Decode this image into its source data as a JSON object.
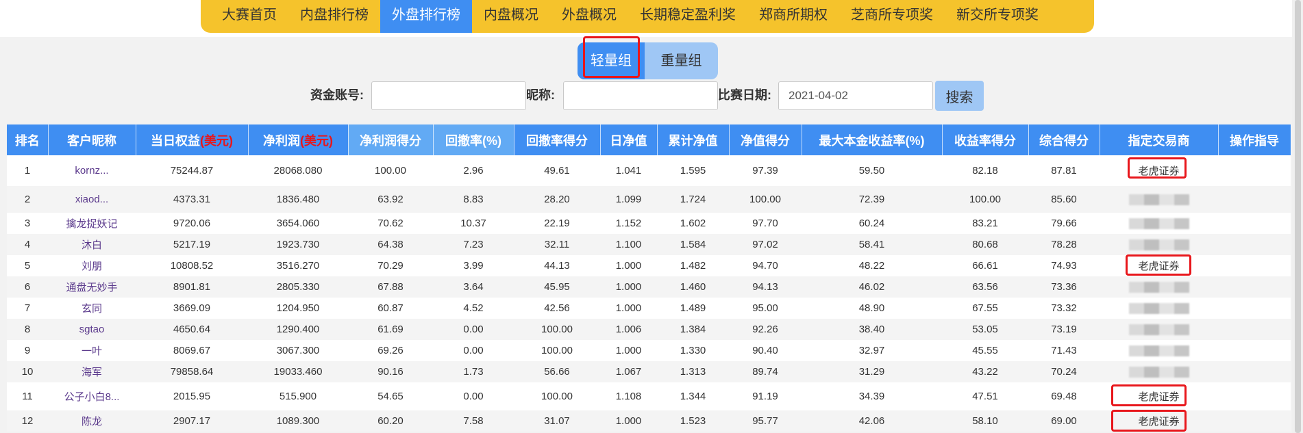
{
  "nav": {
    "items": [
      {
        "label": "大赛首页",
        "active": false
      },
      {
        "label": "内盘排行榜",
        "active": false
      },
      {
        "label": "外盘排行榜",
        "active": true
      },
      {
        "label": "内盘概况",
        "active": false
      },
      {
        "label": "外盘概况",
        "active": false
      },
      {
        "label": "长期稳定盈利奖",
        "active": false
      },
      {
        "label": "郑商所期权",
        "active": false
      },
      {
        "label": "芝商所专项奖",
        "active": false
      },
      {
        "label": "新交所专项奖",
        "active": false
      }
    ]
  },
  "groups": {
    "light": "轻量组",
    "heavy": "重量组"
  },
  "search": {
    "account_label": "资金账号:",
    "account_value": "",
    "nickname_label": "昵称:",
    "nickname_value": "",
    "date_label": "比赛日期:",
    "date_value": "2021-04-02",
    "button": "搜索"
  },
  "table": {
    "headers": {
      "rank": "排名",
      "nickname": "客户昵称",
      "equity": "当日权益",
      "profit": "净利润",
      "usd": "(美元)",
      "profit_score": "净利润得分",
      "drawdown": "回撤率(%)",
      "drawdown_score": "回撤率得分",
      "daily_nav": "日净值",
      "cum_nav": "累计净值",
      "nav_score": "净值得分",
      "max_return": "最大本金收益率(%)",
      "return_score": "收益率得分",
      "total_score": "综合得分",
      "broker": "指定交易商",
      "guide": "操作指导"
    },
    "rows": [
      {
        "rank": "1",
        "nickname": "kornz...",
        "equity": "75244.87",
        "profit": "28068.080",
        "profit_score": "100.00",
        "drawdown": "2.96",
        "drawdown_score": "49.61",
        "daily_nav": "1.041",
        "cum_nav": "1.595",
        "nav_score": "97.39",
        "max_return": "59.50",
        "return_score": "82.18",
        "total_score": "87.81",
        "broker": "老虎证券"
      },
      {
        "rank": "2",
        "nickname": "xiaod...",
        "equity": "4373.31",
        "profit": "1836.480",
        "profit_score": "63.92",
        "drawdown": "8.83",
        "drawdown_score": "28.20",
        "daily_nav": "1.099",
        "cum_nav": "1.724",
        "nav_score": "100.00",
        "max_return": "72.39",
        "return_score": "100.00",
        "total_score": "85.60",
        "broker": ""
      },
      {
        "rank": "3",
        "nickname": "擒龙捉妖记",
        "equity": "9720.06",
        "profit": "3654.060",
        "profit_score": "70.62",
        "drawdown": "10.37",
        "drawdown_score": "22.19",
        "daily_nav": "1.152",
        "cum_nav": "1.602",
        "nav_score": "97.70",
        "max_return": "60.24",
        "return_score": "83.21",
        "total_score": "79.66",
        "broker": ""
      },
      {
        "rank": "4",
        "nickname": "沐白",
        "equity": "5217.19",
        "profit": "1923.730",
        "profit_score": "64.38",
        "drawdown": "7.23",
        "drawdown_score": "32.11",
        "daily_nav": "1.100",
        "cum_nav": "1.584",
        "nav_score": "97.02",
        "max_return": "58.41",
        "return_score": "80.68",
        "total_score": "78.28",
        "broker": ""
      },
      {
        "rank": "5",
        "nickname": "刘朋",
        "equity": "10808.52",
        "profit": "3516.270",
        "profit_score": "70.29",
        "drawdown": "3.99",
        "drawdown_score": "44.13",
        "daily_nav": "1.000",
        "cum_nav": "1.482",
        "nav_score": "94.70",
        "max_return": "48.22",
        "return_score": "66.61",
        "total_score": "74.93",
        "broker": "老虎证券"
      },
      {
        "rank": "6",
        "nickname": "通盘无妙手",
        "equity": "8901.81",
        "profit": "2805.330",
        "profit_score": "67.88",
        "drawdown": "3.64",
        "drawdown_score": "45.95",
        "daily_nav": "1.000",
        "cum_nav": "1.460",
        "nav_score": "94.13",
        "max_return": "46.02",
        "return_score": "63.56",
        "total_score": "73.36",
        "broker": ""
      },
      {
        "rank": "7",
        "nickname": "玄同",
        "equity": "3669.09",
        "profit": "1204.950",
        "profit_score": "60.87",
        "drawdown": "4.52",
        "drawdown_score": "42.56",
        "daily_nav": "1.000",
        "cum_nav": "1.489",
        "nav_score": "95.00",
        "max_return": "48.90",
        "return_score": "67.55",
        "total_score": "73.32",
        "broker": ""
      },
      {
        "rank": "8",
        "nickname": "sgtao",
        "equity": "4650.64",
        "profit": "1290.400",
        "profit_score": "61.69",
        "drawdown": "0.00",
        "drawdown_score": "100.00",
        "daily_nav": "1.006",
        "cum_nav": "1.384",
        "nav_score": "92.26",
        "max_return": "38.40",
        "return_score": "53.05",
        "total_score": "73.19",
        "broker": ""
      },
      {
        "rank": "9",
        "nickname": "一叶",
        "equity": "8069.67",
        "profit": "3067.300",
        "profit_score": "69.26",
        "drawdown": "0.00",
        "drawdown_score": "100.00",
        "daily_nav": "1.000",
        "cum_nav": "1.330",
        "nav_score": "90.40",
        "max_return": "32.97",
        "return_score": "45.55",
        "total_score": "71.43",
        "broker": ""
      },
      {
        "rank": "10",
        "nickname": "海军",
        "equity": "79858.64",
        "profit": "19033.460",
        "profit_score": "90.16",
        "drawdown": "1.73",
        "drawdown_score": "56.66",
        "daily_nav": "1.067",
        "cum_nav": "1.313",
        "nav_score": "89.74",
        "max_return": "31.29",
        "return_score": "43.22",
        "total_score": "70.24",
        "broker": ""
      },
      {
        "rank": "11",
        "nickname": "公子小白8...",
        "equity": "2015.95",
        "profit": "515.900",
        "profit_score": "54.65",
        "drawdown": "0.00",
        "drawdown_score": "100.00",
        "daily_nav": "1.108",
        "cum_nav": "1.344",
        "nav_score": "91.19",
        "max_return": "34.39",
        "return_score": "47.51",
        "total_score": "69.48",
        "broker": "老虎证券"
      },
      {
        "rank": "12",
        "nickname": "陈龙",
        "equity": "2907.17",
        "profit": "1089.300",
        "profit_score": "60.20",
        "drawdown": "7.58",
        "drawdown_score": "31.07",
        "daily_nav": "1.000",
        "cum_nav": "1.523",
        "nav_score": "95.77",
        "max_return": "42.06",
        "return_score": "58.10",
        "total_score": "69.00",
        "broker": "老虎证券"
      }
    ]
  },
  "colors": {
    "nav_bg": "#f5c32c",
    "active_blue": "#3f8ef2",
    "light_blue": "#9fc7f5",
    "highlight_red": "#e8161b"
  }
}
